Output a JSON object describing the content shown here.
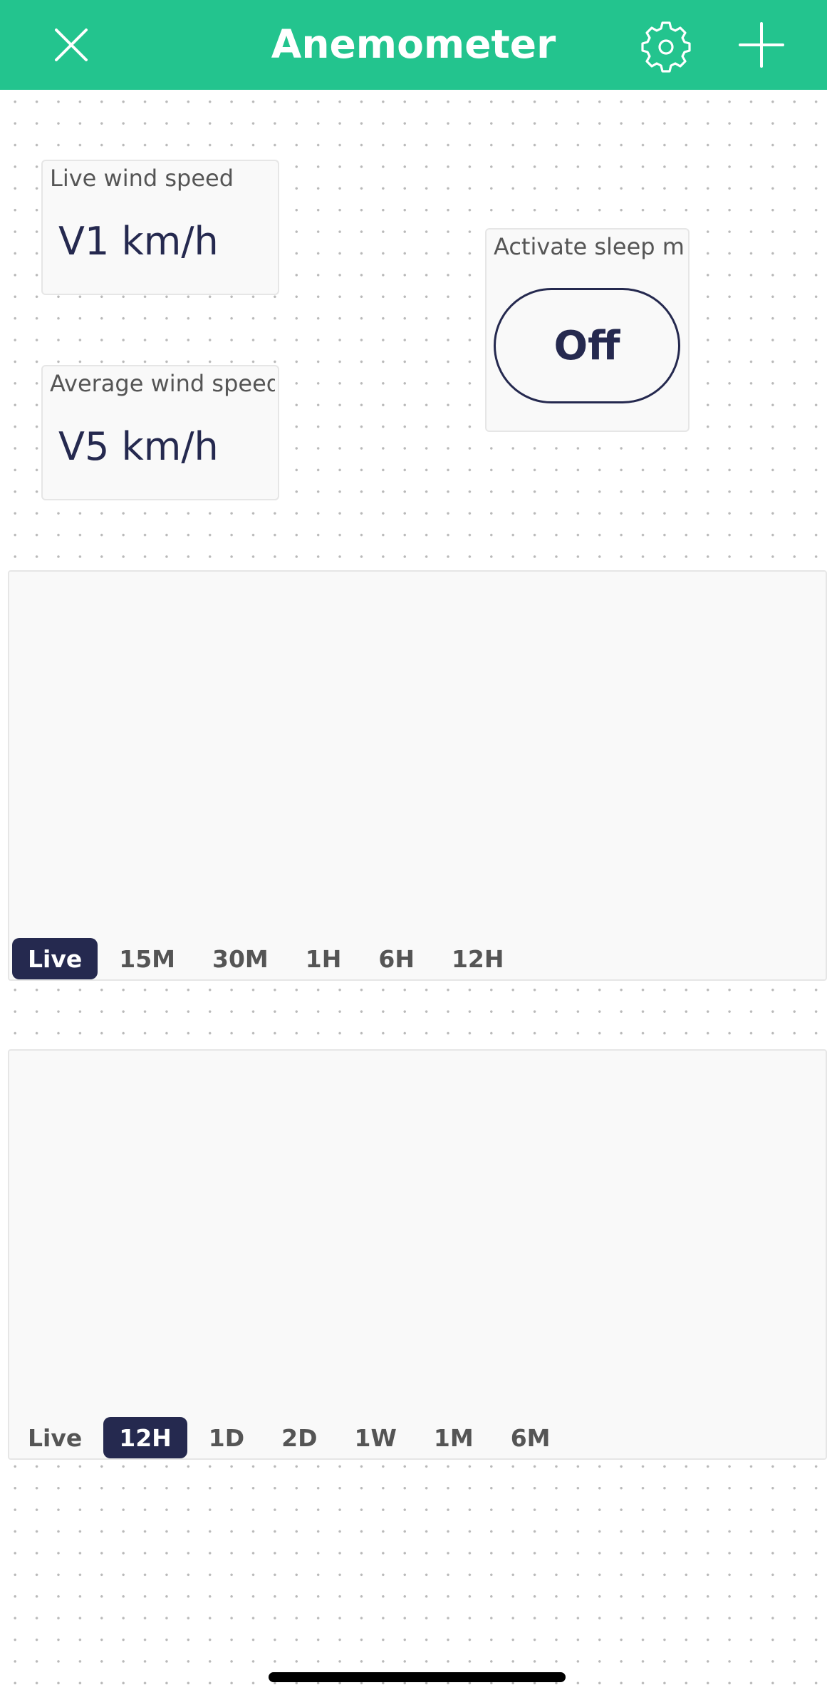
{
  "header": {
    "title": "Anemometer",
    "close_icon": "close-icon",
    "settings_icon": "gear-icon",
    "add_icon": "plus-icon",
    "background": "#23c48e"
  },
  "widgets": {
    "live_wind": {
      "label": "Live wind speed",
      "value": "V1 km/h"
    },
    "avg_wind": {
      "label": "Average wind speed",
      "value": "V5 km/h"
    },
    "sleep": {
      "label": "Activate sleep mode",
      "state": "Off"
    }
  },
  "chart1": {
    "periods": [
      "Live",
      "15M",
      "30M",
      "1H",
      "6H",
      "12H"
    ],
    "selected": "Live"
  },
  "chart2": {
    "periods": [
      "Live",
      "12H",
      "1D",
      "2D",
      "1W",
      "1M",
      "6M"
    ],
    "selected": "12H"
  },
  "colors": {
    "accent": "#23c48e",
    "primary_dark": "#25294f"
  }
}
